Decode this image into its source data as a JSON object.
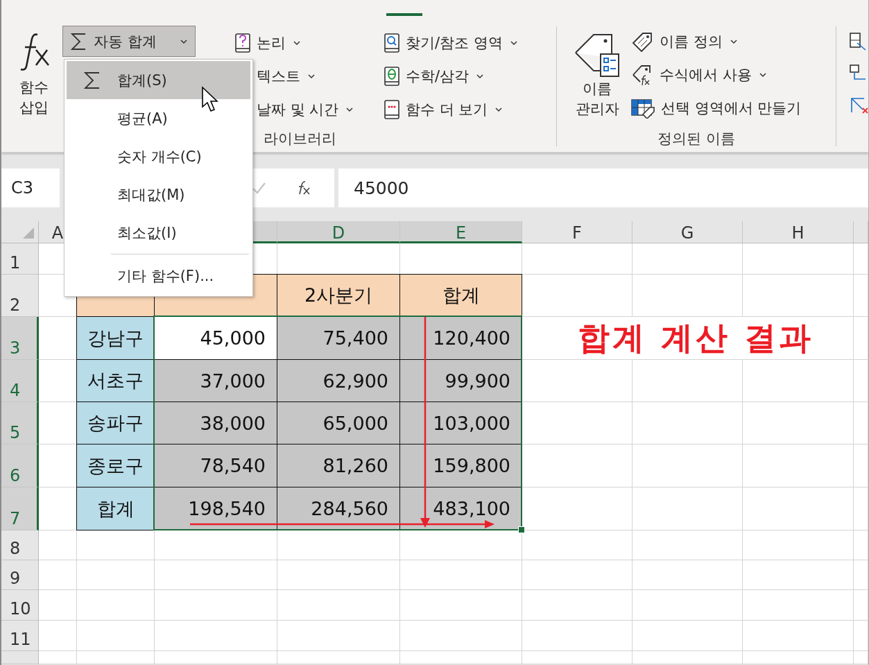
{
  "ribbon": {
    "insert_function": {
      "label": "함수 삽입"
    },
    "autosum": {
      "label": "자동 합계",
      "pressed": true
    },
    "function_columns": [
      [
        {
          "label": "논리",
          "kind": "logic"
        },
        {
          "label": "텍스트",
          "kind": "text"
        },
        {
          "label": "날짜 및 시간",
          "kind": "date"
        }
      ],
      [
        {
          "label": "찾기/참조 영역",
          "kind": "lookup"
        },
        {
          "label": "수학/삼각",
          "kind": "math"
        },
        {
          "label": "함수 더 보기",
          "kind": "more"
        }
      ]
    ],
    "library_group_label": "라이브러리",
    "name_manager": {
      "label": "이름 관리자"
    },
    "name_commands": [
      {
        "label": "이름 정의",
        "kind": "tag",
        "dropdown": true
      },
      {
        "label": "수식에서 사용",
        "kind": "fxtag",
        "dropdown": true
      },
      {
        "label": "선택 영역에서 만들기",
        "kind": "create",
        "dropdown": false
      }
    ],
    "names_group_label": "정의된 이름"
  },
  "autosum_menu": {
    "items": [
      {
        "kind": "item",
        "label": "합계(S)",
        "sigma": true,
        "selected": true
      },
      {
        "kind": "item",
        "label": "평균(A)",
        "sigma": false,
        "selected": false
      },
      {
        "kind": "item",
        "label": "숫자 개수(C)",
        "sigma": false,
        "selected": false
      },
      {
        "kind": "item",
        "label": "최대값(M)",
        "sigma": false,
        "selected": false
      },
      {
        "kind": "item",
        "label": "최소값(I)",
        "sigma": false,
        "selected": false
      },
      {
        "kind": "separator"
      },
      {
        "kind": "item",
        "label": "기타 함수(F)...",
        "sigma": false,
        "selected": false
      }
    ]
  },
  "formula_bar": {
    "name_box": "C3",
    "value": "45000"
  },
  "sheet": {
    "columns": [
      {
        "label": "A",
        "selected": false
      },
      {},
      {
        "selected": true
      },
      {
        "label": "D",
        "selected": true
      },
      {
        "label": "E",
        "selected": true
      },
      {
        "label": "F",
        "selected": false
      },
      {
        "label": "G",
        "selected": false
      },
      {
        "label": "H",
        "selected": false
      }
    ],
    "rows": [
      {
        "label": "1",
        "selected": false
      },
      {
        "label": "2",
        "selected": false
      },
      {
        "label": "3",
        "selected": true
      },
      {
        "label": "4",
        "selected": true
      },
      {
        "label": "5",
        "selected": true
      },
      {
        "label": "6",
        "selected": true
      },
      {
        "label": "7",
        "selected": true
      },
      {
        "label": "8",
        "selected": false
      },
      {
        "label": "9",
        "selected": false
      },
      {
        "label": "10",
        "selected": false
      },
      {
        "label": "11",
        "selected": false
      }
    ],
    "table": {
      "header": [
        "2사분기",
        "합계"
      ],
      "rows": [
        {
          "region": "강남구",
          "values": [
            {
              "text": "45,000",
              "selected": false
            },
            {
              "text": "75,400",
              "selected": true
            },
            {
              "text": "120,400",
              "selected": true
            }
          ]
        },
        {
          "region": "서초구",
          "values": [
            {
              "text": "37,000",
              "selected": true
            },
            {
              "text": "62,900",
              "selected": true
            },
            {
              "text": "99,900",
              "selected": true
            }
          ]
        },
        {
          "region": "송파구",
          "values": [
            {
              "text": "38,000",
              "selected": true
            },
            {
              "text": "65,000",
              "selected": true
            },
            {
              "text": "103,000",
              "selected": true
            }
          ]
        },
        {
          "region": "종로구",
          "values": [
            {
              "text": "78,540",
              "selected": true
            },
            {
              "text": "81,260",
              "selected": true
            },
            {
              "text": "159,800",
              "selected": true
            }
          ]
        },
        {
          "region": "합계",
          "values": [
            {
              "text": "198,540",
              "selected": true
            },
            {
              "text": "284,560",
              "selected": true
            },
            {
              "text": "483,100",
              "selected": true
            }
          ]
        }
      ]
    },
    "annotation": "합계 계산 결과"
  }
}
